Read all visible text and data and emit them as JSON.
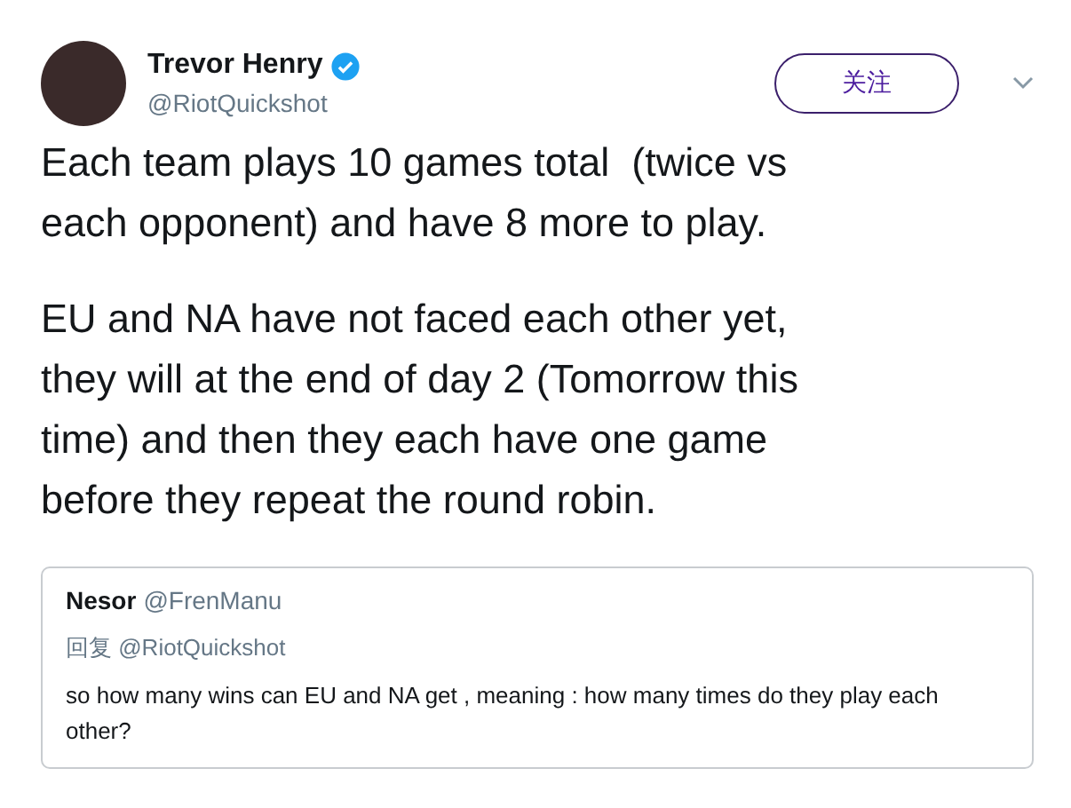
{
  "author": {
    "name": "Trevor Henry",
    "verified": true,
    "handle": "@RiotQuickshot"
  },
  "follow_button": {
    "label": "关注"
  },
  "paragraphs": [
    [
      "Each team plays 10 games total  (twice vs",
      "each opponent) and have 8 more to play."
    ],
    [
      "EU and NA have not faced each other yet,",
      "they will at the end of day 2 (Tomorrow this",
      "time) and then they each have one game",
      "before they repeat the round robin."
    ]
  ],
  "quoted_tweet": {
    "name": "Nesor",
    "handle": "@FrenManu",
    "reply_to": "回复 @RiotQuickshot",
    "text": "so how many wins can EU and NA get , meaning : how many times do they play each other?"
  }
}
